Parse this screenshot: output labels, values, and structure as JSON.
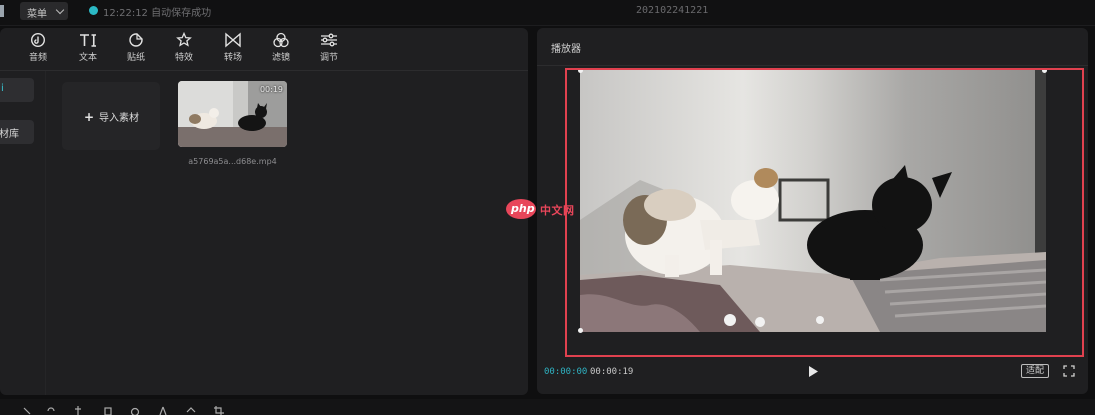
{
  "topbar": {
    "menu_label": "菜单",
    "status_text": "12:22:12 自动保存成功",
    "project_title": "202102241221"
  },
  "tool_tabs": [
    {
      "label": "音频",
      "icon": "audio-icon"
    },
    {
      "label": "文本",
      "icon": "text-icon"
    },
    {
      "label": "贴纸",
      "icon": "sticker-icon"
    },
    {
      "label": "特效",
      "icon": "effects-icon"
    },
    {
      "label": "转场",
      "icon": "transition-icon"
    },
    {
      "label": "滤镜",
      "icon": "filter-icon"
    },
    {
      "label": "调节",
      "icon": "adjust-icon"
    }
  ],
  "side_nav": [
    {
      "label": "i",
      "active": true
    },
    {
      "label": "素材库",
      "active": false
    }
  ],
  "media": {
    "import_label": "导入素材",
    "clip_name": "a5769a5a...d68e.mp4",
    "clip_duration": "00:19"
  },
  "player": {
    "title": "播放器",
    "time_current": "00:00:00",
    "time_total": "00:00:19",
    "ratio_label": "适配"
  },
  "watermark": {
    "php": "php",
    "text": "中文网"
  },
  "colors": {
    "accent": "#2fb2c2",
    "highlight": "#e0414f",
    "panel": "#1f1f21"
  }
}
